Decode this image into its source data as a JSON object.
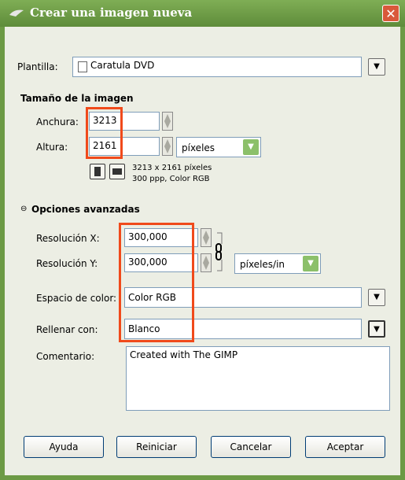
{
  "window": {
    "title": "Crear una imagen nueva"
  },
  "template": {
    "label": "Plantilla:",
    "value": "Caratula DVD"
  },
  "image_size": {
    "heading": "Tamaño de la imagen",
    "width_label": "Anchura:",
    "width_value": "3213",
    "height_label": "Altura:",
    "height_value": "2161",
    "unit": "píxeles",
    "info_line1": "3213 x 2161 píxeles",
    "info_line2": "300 ppp, Color RGB"
  },
  "advanced": {
    "heading": "Opciones avanzadas",
    "res_x_label": "Resolución X:",
    "res_x_value": "300,000",
    "res_y_label": "Resolución Y:",
    "res_y_value": "300,000",
    "res_unit": "píxeles/in",
    "colorspace_label": "Espacio de color:",
    "colorspace_value": "Color RGB",
    "fill_label": "Rellenar con:",
    "fill_value": "Blanco",
    "comment_label": "Comentario:",
    "comment_value": "Created with The GIMP"
  },
  "buttons": {
    "help": "Ayuda",
    "reset": "Reiniciar",
    "cancel": "Cancelar",
    "accept": "Aceptar"
  },
  "colors": {
    "titlebar": "#6c9a45",
    "highlight": "#f04a1b",
    "client": "#eceee4"
  }
}
